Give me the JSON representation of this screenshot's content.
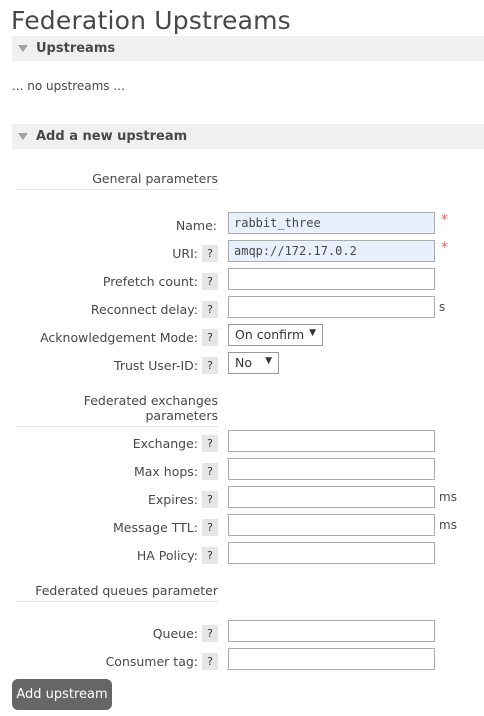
{
  "title": "Federation Upstreams",
  "upstreams": {
    "header": "Upstreams",
    "empty_text": "... no upstreams ..."
  },
  "add": {
    "header": "Add a new upstream",
    "general_title": "General parameters",
    "name": {
      "label": "Name:",
      "value": "rabbit_three",
      "required": "*"
    },
    "uri": {
      "label": "URI:",
      "help": "?",
      "value": "amqp://172.17.0.2",
      "required": "*"
    },
    "prefetch": {
      "label": "Prefetch count:",
      "help": "?",
      "value": ""
    },
    "reconnect": {
      "label": "Reconnect delay:",
      "help": "?",
      "value": "",
      "unit": "s"
    },
    "ack_mode": {
      "label": "Acknowledgement Mode:",
      "help": "?",
      "value": "On confirm"
    },
    "trust": {
      "label": "Trust User-ID:",
      "help": "?",
      "value": "No"
    },
    "exchanges_title": "Federated exchanges parameters",
    "exchange": {
      "label": "Exchange:",
      "help": "?",
      "value": ""
    },
    "max_hops": {
      "label": "Max hops:",
      "help": "?",
      "value": ""
    },
    "expires": {
      "label": "Expires:",
      "help": "?",
      "value": "",
      "unit": "ms"
    },
    "message_ttl": {
      "label": "Message TTL:",
      "help": "?",
      "value": "",
      "unit": "ms"
    },
    "ha_policy": {
      "label": "HA Policy:",
      "help": "?",
      "value": ""
    },
    "queues_title": "Federated queues parameter",
    "queue": {
      "label": "Queue:",
      "help": "?",
      "value": ""
    },
    "consumer_tag": {
      "label": "Consumer tag:",
      "help": "?",
      "value": ""
    },
    "submit": "Add upstream"
  },
  "icons": {
    "collapse": "triangle-down-icon",
    "dropdown": "chevron-down-icon"
  },
  "colors": {
    "required": "#d96b6b",
    "button": "#666666",
    "filled_field": "#e8f0fe"
  }
}
